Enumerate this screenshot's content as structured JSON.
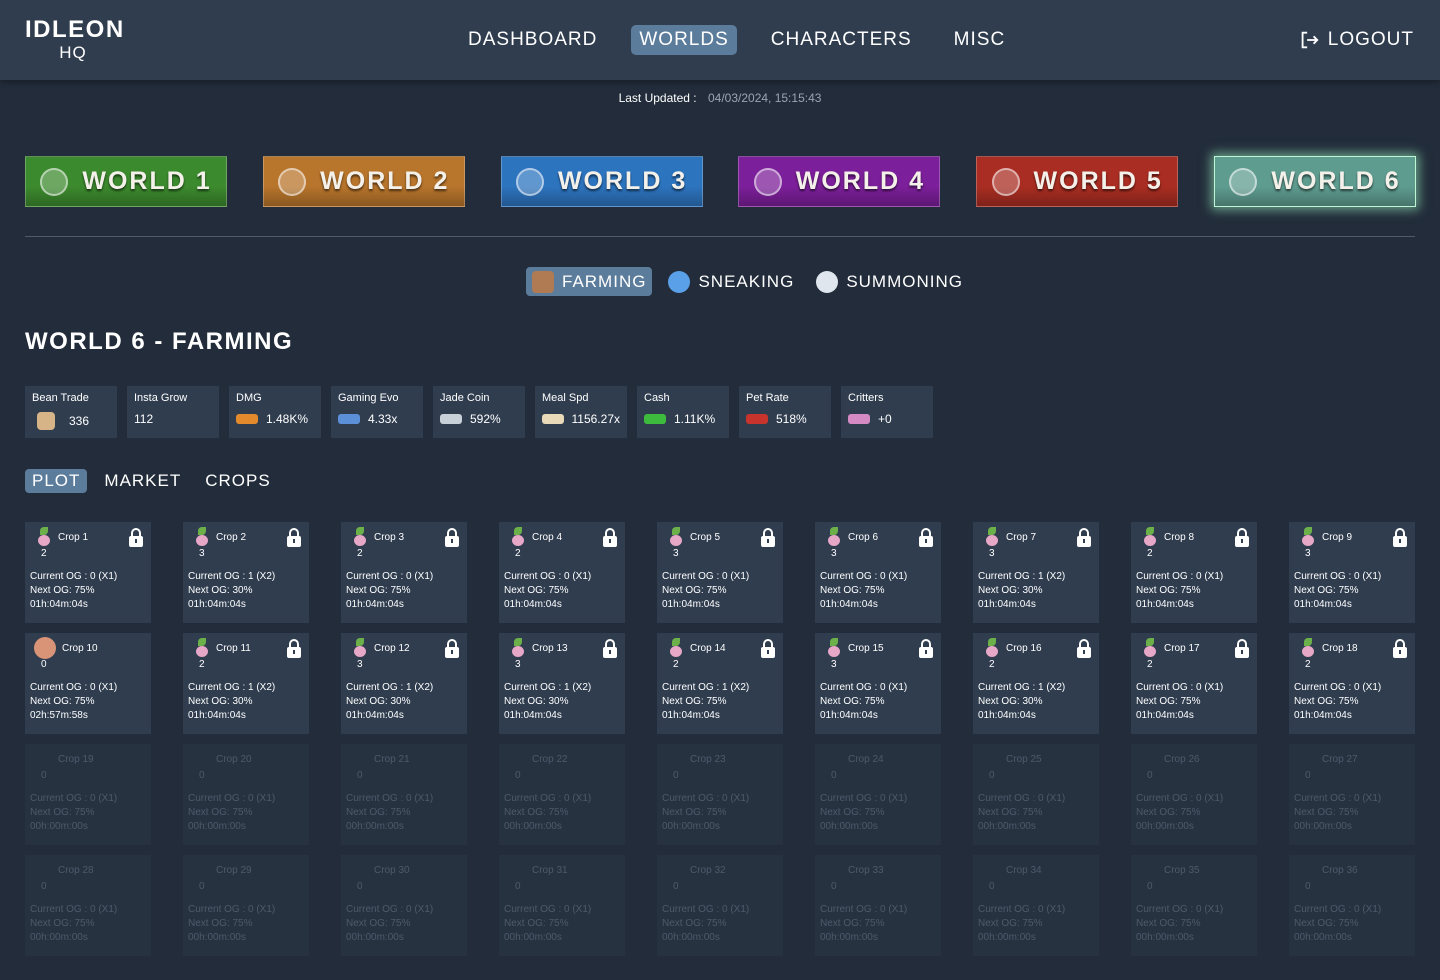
{
  "header": {
    "logo_line1": "IDLEON",
    "logo_line2": "HQ",
    "nav": [
      "DASHBOARD",
      "WORLDS",
      "CHARACTERS",
      "MISC"
    ],
    "active_nav": "WORLDS",
    "logout_label": "LOGOUT"
  },
  "updated": {
    "label": "Last Updated :",
    "value": "04/03/2024, 15:15:43"
  },
  "worlds": [
    {
      "label": "WORLD 1",
      "color": "#3c8a2e"
    },
    {
      "label": "WORLD 2",
      "color": "#b8752c"
    },
    {
      "label": "WORLD 3",
      "color": "#2d74bf"
    },
    {
      "label": "WORLD 4",
      "color": "#7c1f9a"
    },
    {
      "label": "WORLD 5",
      "color": "#a92d22"
    },
    {
      "label": "WORLD 6",
      "color": "#5f9c90"
    }
  ],
  "subtabs": [
    "FARMING",
    "SNEAKING",
    "SUMMONING"
  ],
  "page_title": "WORLD 6 - FARMING",
  "stats": [
    {
      "label": "Bean Trade",
      "value": "336",
      "icon": "bean-icon",
      "color": "#d7b487"
    },
    {
      "label": "Insta Grow",
      "value": "112",
      "icon": "",
      "color": ""
    },
    {
      "label": "DMG",
      "value": "1.48K%",
      "icon": "dmg-icon",
      "color": "#e38a2c"
    },
    {
      "label": "Gaming Evo",
      "value": "4.33x",
      "icon": "gaming-icon",
      "color": "#5b8fd8"
    },
    {
      "label": "Jade Coin",
      "value": "592%",
      "icon": "jade-icon",
      "color": "#c9d1d8"
    },
    {
      "label": "Meal Spd",
      "value": "1156.27x",
      "icon": "meal-icon",
      "color": "#e8d9b8"
    },
    {
      "label": "Cash",
      "value": "1.11K%",
      "icon": "cash-icon",
      "color": "#3dbb3d"
    },
    {
      "label": "Pet Rate",
      "value": "518%",
      "icon": "pet-icon",
      "color": "#c8332c"
    },
    {
      "label": "Critters",
      "value": "+0",
      "icon": "critters-icon",
      "color": "#d58ac4"
    }
  ],
  "plot_tabs": [
    "PLOT",
    "MARKET",
    "CROPS"
  ],
  "crops": [
    {
      "name": "Crop 1",
      "num": "2",
      "og": "Current OG : 0 (X1)",
      "next": "Next OG: 75%",
      "time": "01h:04m:04s",
      "active": true
    },
    {
      "name": "Crop 2",
      "num": "3",
      "og": "Current OG : 1 (X2)",
      "next": "Next OG: 30%",
      "time": "01h:04m:04s",
      "active": true
    },
    {
      "name": "Crop 3",
      "num": "2",
      "og": "Current OG : 0 (X1)",
      "next": "Next OG: 75%",
      "time": "01h:04m:04s",
      "active": true
    },
    {
      "name": "Crop 4",
      "num": "2",
      "og": "Current OG : 0 (X1)",
      "next": "Next OG: 75%",
      "time": "01h:04m:04s",
      "active": true
    },
    {
      "name": "Crop 5",
      "num": "3",
      "og": "Current OG : 0 (X1)",
      "next": "Next OG: 75%",
      "time": "01h:04m:04s",
      "active": true
    },
    {
      "name": "Crop 6",
      "num": "3",
      "og": "Current OG : 0 (X1)",
      "next": "Next OG: 75%",
      "time": "01h:04m:04s",
      "active": true
    },
    {
      "name": "Crop 7",
      "num": "3",
      "og": "Current OG : 1 (X2)",
      "next": "Next OG: 30%",
      "time": "01h:04m:04s",
      "active": true
    },
    {
      "name": "Crop 8",
      "num": "2",
      "og": "Current OG : 0 (X1)",
      "next": "Next OG: 75%",
      "time": "01h:04m:04s",
      "active": true
    },
    {
      "name": "Crop 9",
      "num": "3",
      "og": "Current OG : 0 (X1)",
      "next": "Next OG: 75%",
      "time": "01h:04m:04s",
      "active": true
    },
    {
      "name": "Crop 10",
      "num": "0",
      "og": "Current OG : 0 (X1)",
      "next": "Next OG: 75%",
      "time": "02h:57m:58s",
      "active": true,
      "special": true
    },
    {
      "name": "Crop 11",
      "num": "2",
      "og": "Current OG : 1 (X2)",
      "next": "Next OG: 30%",
      "time": "01h:04m:04s",
      "active": true
    },
    {
      "name": "Crop 12",
      "num": "3",
      "og": "Current OG : 1 (X2)",
      "next": "Next OG: 30%",
      "time": "01h:04m:04s",
      "active": true
    },
    {
      "name": "Crop 13",
      "num": "3",
      "og": "Current OG : 1 (X2)",
      "next": "Next OG: 30%",
      "time": "01h:04m:04s",
      "active": true
    },
    {
      "name": "Crop 14",
      "num": "2",
      "og": "Current OG : 1 (X2)",
      "next": "Next OG: 75%",
      "time": "01h:04m:04s",
      "active": true
    },
    {
      "name": "Crop 15",
      "num": "3",
      "og": "Current OG : 0 (X1)",
      "next": "Next OG: 75%",
      "time": "01h:04m:04s",
      "active": true
    },
    {
      "name": "Crop 16",
      "num": "2",
      "og": "Current OG : 1 (X2)",
      "next": "Next OG: 30%",
      "time": "01h:04m:04s",
      "active": true
    },
    {
      "name": "Crop 17",
      "num": "2",
      "og": "Current OG : 0 (X1)",
      "next": "Next OG: 75%",
      "time": "01h:04m:04s",
      "active": true
    },
    {
      "name": "Crop 18",
      "num": "2",
      "og": "Current OG : 0 (X1)",
      "next": "Next OG: 75%",
      "time": "01h:04m:04s",
      "active": true
    },
    {
      "name": "Crop 19",
      "num": "0",
      "og": "Current OG : 0 (X1)",
      "next": "Next OG: 75%",
      "time": "00h:00m:00s",
      "active": false
    },
    {
      "name": "Crop 20",
      "num": "0",
      "og": "Current OG : 0 (X1)",
      "next": "Next OG: 75%",
      "time": "00h:00m:00s",
      "active": false
    },
    {
      "name": "Crop 21",
      "num": "0",
      "og": "Current OG : 0 (X1)",
      "next": "Next OG: 75%",
      "time": "00h:00m:00s",
      "active": false
    },
    {
      "name": "Crop 22",
      "num": "0",
      "og": "Current OG : 0 (X1)",
      "next": "Next OG: 75%",
      "time": "00h:00m:00s",
      "active": false
    },
    {
      "name": "Crop 23",
      "num": "0",
      "og": "Current OG : 0 (X1)",
      "next": "Next OG: 75%",
      "time": "00h:00m:00s",
      "active": false
    },
    {
      "name": "Crop 24",
      "num": "0",
      "og": "Current OG : 0 (X1)",
      "next": "Next OG: 75%",
      "time": "00h:00m:00s",
      "active": false
    },
    {
      "name": "Crop 25",
      "num": "0",
      "og": "Current OG : 0 (X1)",
      "next": "Next OG: 75%",
      "time": "00h:00m:00s",
      "active": false
    },
    {
      "name": "Crop 26",
      "num": "0",
      "og": "Current OG : 0 (X1)",
      "next": "Next OG: 75%",
      "time": "00h:00m:00s",
      "active": false
    },
    {
      "name": "Crop 27",
      "num": "0",
      "og": "Current OG : 0 (X1)",
      "next": "Next OG: 75%",
      "time": "00h:00m:00s",
      "active": false
    },
    {
      "name": "Crop 28",
      "num": "0",
      "og": "Current OG : 0 (X1)",
      "next": "Next OG: 75%",
      "time": "00h:00m:00s",
      "active": false
    },
    {
      "name": "Crop 29",
      "num": "0",
      "og": "Current OG : 0 (X1)",
      "next": "Next OG: 75%",
      "time": "00h:00m:00s",
      "active": false
    },
    {
      "name": "Crop 30",
      "num": "0",
      "og": "Current OG : 0 (X1)",
      "next": "Next OG: 75%",
      "time": "00h:00m:00s",
      "active": false
    },
    {
      "name": "Crop 31",
      "num": "0",
      "og": "Current OG : 0 (X1)",
      "next": "Next OG: 75%",
      "time": "00h:00m:00s",
      "active": false
    },
    {
      "name": "Crop 32",
      "num": "0",
      "og": "Current OG : 0 (X1)",
      "next": "Next OG: 75%",
      "time": "00h:00m:00s",
      "active": false
    },
    {
      "name": "Crop 33",
      "num": "0",
      "og": "Current OG : 0 (X1)",
      "next": "Next OG: 75%",
      "time": "00h:00m:00s",
      "active": false
    },
    {
      "name": "Crop 34",
      "num": "0",
      "og": "Current OG : 0 (X1)",
      "next": "Next OG: 75%",
      "time": "00h:00m:00s",
      "active": false
    },
    {
      "name": "Crop 35",
      "num": "0",
      "og": "Current OG : 0 (X1)",
      "next": "Next OG: 75%",
      "time": "00h:00m:00s",
      "active": false
    },
    {
      "name": "Crop 36",
      "num": "0",
      "og": "Current OG : 0 (X1)",
      "next": "Next OG: 75%",
      "time": "00h:00m:00s",
      "active": false
    }
  ]
}
